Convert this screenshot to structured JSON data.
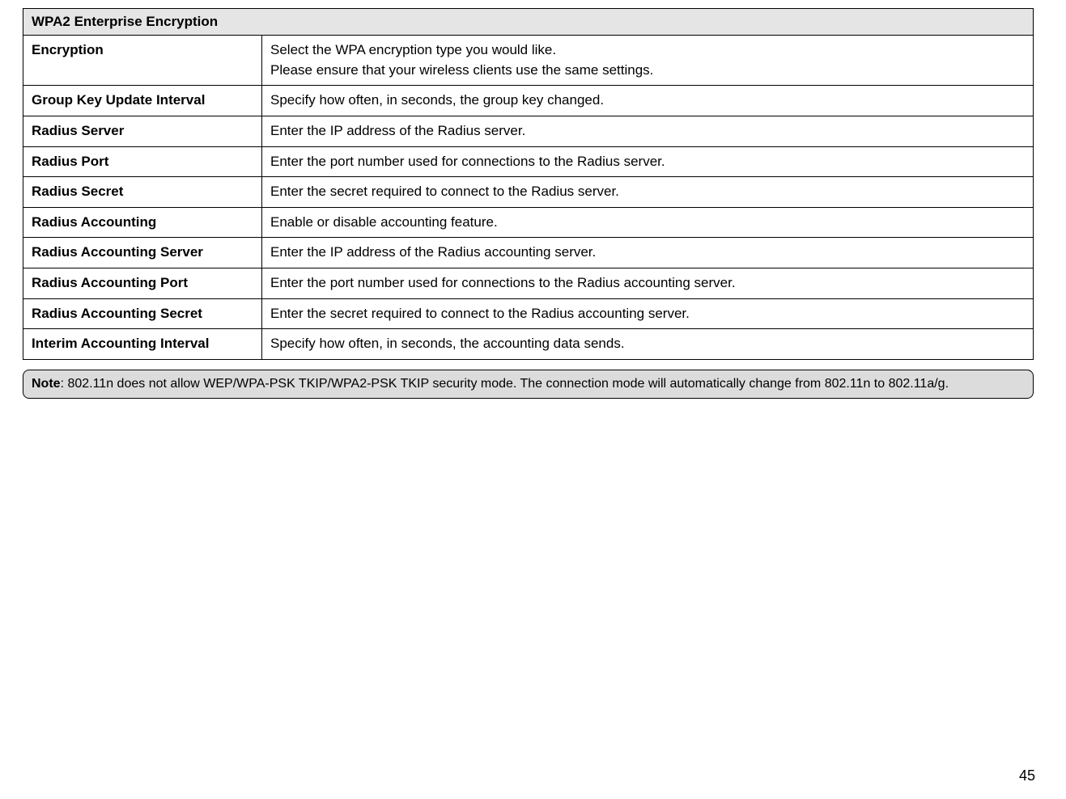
{
  "table": {
    "title": "WPA2 Enterprise Encryption",
    "rows": [
      {
        "label": "Encryption",
        "desc": "Select the WPA encryption type you would like.\nPlease ensure that your wireless clients use the same settings."
      },
      {
        "label": "Group Key Update Interval",
        "desc": "Specify how often, in seconds, the group key changed."
      },
      {
        "label": "Radius Server",
        "desc": "Enter the IP address of the Radius server."
      },
      {
        "label": "Radius Port",
        "desc": "Enter the port number used for connections to the Radius server."
      },
      {
        "label": "Radius Secret",
        "desc": "Enter the secret required to connect to the Radius server."
      },
      {
        "label": "Radius Accounting",
        "desc": "Enable or disable accounting feature."
      },
      {
        "label": "Radius Accounting Server",
        "desc": "Enter the IP address of the Radius accounting server."
      },
      {
        "label": "Radius Accounting Port",
        "desc": "Enter the port number used for connections to the Radius accounting server."
      },
      {
        "label": "Radius Accounting Secret",
        "desc": "Enter the secret required to connect to the Radius accounting server."
      },
      {
        "label": "Interim Accounting Interval",
        "desc": "Specify how often, in seconds, the accounting data sends."
      }
    ]
  },
  "note": {
    "label": "Note",
    "text": ":  802.11n does not allow WEP/WPA-PSK TKIP/WPA2-PSK TKIP security mode. The connection mode will automatically change from 802.11n to 802.11a/g."
  },
  "page_number": "45"
}
